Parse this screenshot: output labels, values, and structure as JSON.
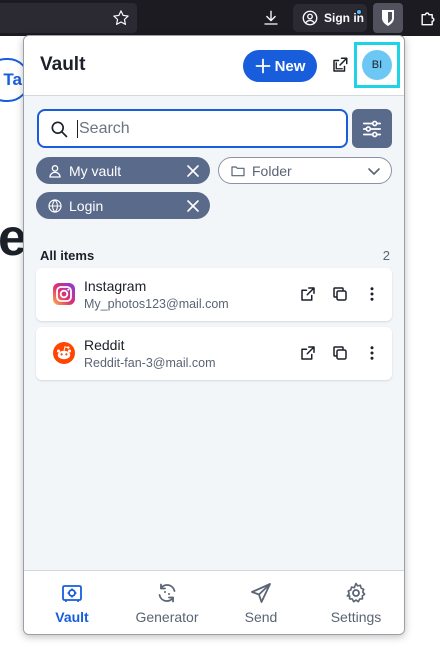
{
  "browser": {
    "signin_label": "Sign in",
    "star_icon": "star-icon",
    "download_icon": "download-icon",
    "account_icon": "account-circle-icon",
    "extension_icon": "bitwarden-shield-icon",
    "puzzle_icon": "puzzle-icon"
  },
  "background_page": {
    "pill_text": "Ta",
    "big_text": "e"
  },
  "header": {
    "title": "Vault",
    "new_label": "New",
    "avatar_initials": "BI",
    "accent": "#175ddc",
    "highlight": "#1fd3e6"
  },
  "search": {
    "placeholder": "Search"
  },
  "filters": {
    "vault_label": "My vault",
    "folder_label": "Folder",
    "type_label": "Login"
  },
  "list": {
    "section_title": "All items",
    "count": "2",
    "items": [
      {
        "name": "Instagram",
        "username": "My_photos123@mail.com",
        "icon": "instagram-icon"
      },
      {
        "name": "Reddit",
        "username": "Reddit-fan-3@mail.com",
        "icon": "reddit-icon"
      }
    ]
  },
  "footer": {
    "tabs": [
      {
        "label": "Vault",
        "icon": "vault-icon",
        "active": true
      },
      {
        "label": "Generator",
        "icon": "generator-icon",
        "active": false
      },
      {
        "label": "Send",
        "icon": "send-icon",
        "active": false
      },
      {
        "label": "Settings",
        "icon": "gear-icon",
        "active": false
      }
    ]
  }
}
